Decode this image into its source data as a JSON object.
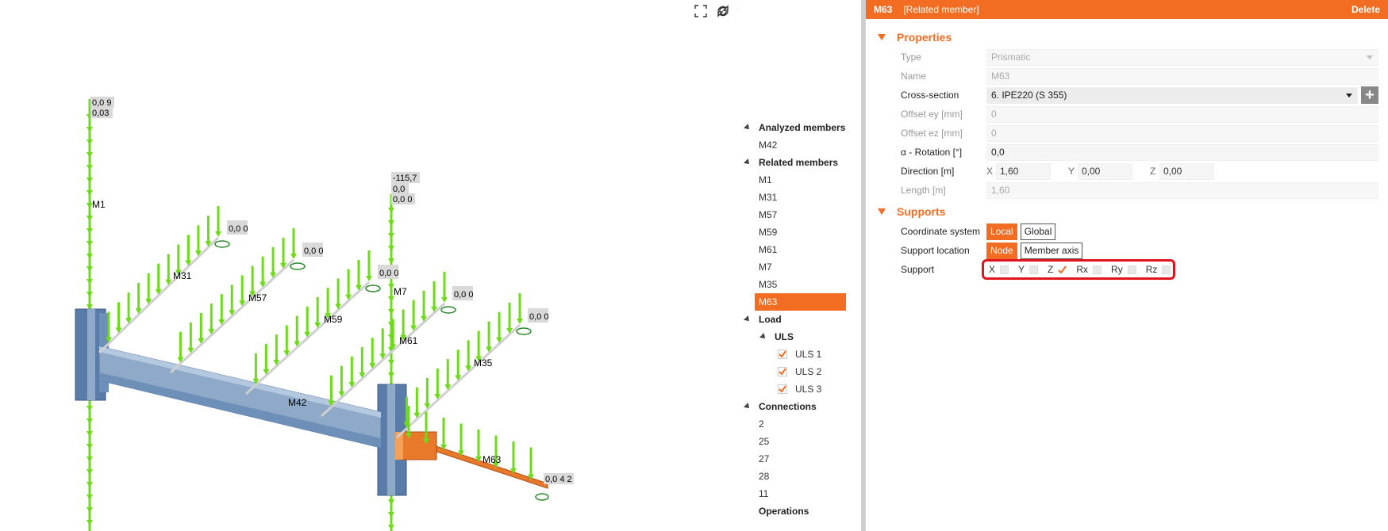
{
  "viewport": {
    "toolbar": [
      {
        "name": "zoom-extents-icon"
      },
      {
        "name": "rotate-icon"
      },
      {
        "name": "view-mode-dropdown-icon"
      },
      {
        "name": "wireframe-view-icon"
      },
      {
        "name": "transparent-view-icon"
      },
      {
        "name": "solid-view-icon"
      },
      {
        "name": "section-view-icon"
      },
      {
        "name": "home-view-icon"
      }
    ],
    "member_labels": {
      "m1": "M1",
      "m31": "M31",
      "m57": "M57",
      "m59": "M59",
      "m7": "M7",
      "m61": "M61",
      "m35": "M35",
      "m42": "M42",
      "m63": "M63"
    },
    "value_labels": {
      "m1_a": "0,0 9",
      "m1_b": "0,03",
      "m7_a": "-115,7",
      "m7_b": "0,0",
      "m7_c": "0,0 0",
      "m31": "0,0 0",
      "m57": "0,0 0",
      "m59": "0,0 0",
      "m61": "0,0 0",
      "m35": "0,0 0",
      "m63": "0,0 4 2"
    }
  },
  "tree": {
    "analyzed": {
      "label": "Analyzed members",
      "items": [
        "M42"
      ]
    },
    "related": {
      "label": "Related members",
      "items": [
        "M1",
        "M31",
        "M57",
        "M59",
        "M61",
        "M7",
        "M35",
        "M63"
      ],
      "selected": "M63"
    },
    "load": {
      "label": "Load",
      "uls": {
        "label": "ULS",
        "items": [
          "ULS 1",
          "ULS 2",
          "ULS 3"
        ]
      }
    },
    "connections": {
      "label": "Connections",
      "items": [
        "2",
        "25",
        "27",
        "28",
        "11"
      ]
    },
    "operations": {
      "label": "Operations"
    }
  },
  "panel": {
    "header": {
      "id": "M63",
      "subtitle": "[Related member]",
      "delete": "Delete"
    },
    "properties": {
      "title": "Properties",
      "type": {
        "label": "Type",
        "value": "Prismatic"
      },
      "name": {
        "label": "Name",
        "value": "M63"
      },
      "cross_section": {
        "label": "Cross-section",
        "value": "6. IPE220 (S 355)",
        "plus": "+"
      },
      "offset_ey": {
        "label": "Offset ey [mm]",
        "value": "0"
      },
      "offset_ez": {
        "label": "Offset ez [mm]",
        "value": "0"
      },
      "rotation": {
        "label": "α - Rotation [°]",
        "value": "0,0"
      },
      "direction": {
        "label": "Direction [m]",
        "x_axis": "X",
        "x": "1,60",
        "y_axis": "Y",
        "y": "0,00",
        "z_axis": "Z",
        "z": "0,00"
      },
      "length": {
        "label": "Length [m]",
        "value": "1,60"
      }
    },
    "supports": {
      "title": "Supports",
      "coordinate_system": {
        "label": "Coordinate system",
        "opt1": "Local",
        "opt2": "Global",
        "active": "Local"
      },
      "support_location": {
        "label": "Support location",
        "opt1": "Node",
        "opt2": "Member axis",
        "active": "Node"
      },
      "support": {
        "label": "Support",
        "items": [
          {
            "key": "X",
            "checked": false
          },
          {
            "key": "Y",
            "checked": false
          },
          {
            "key": "Z",
            "checked": true
          },
          {
            "key": "Rx",
            "checked": false
          },
          {
            "key": "Ry",
            "checked": false
          },
          {
            "key": "Rz",
            "checked": false
          }
        ]
      }
    }
  },
  "colors": {
    "accent": "#f26c22",
    "load_arrow": "#6edb1a",
    "beam": "#8fa9c9",
    "selected_member": "#e8782a",
    "highlight": "#e0141e"
  }
}
